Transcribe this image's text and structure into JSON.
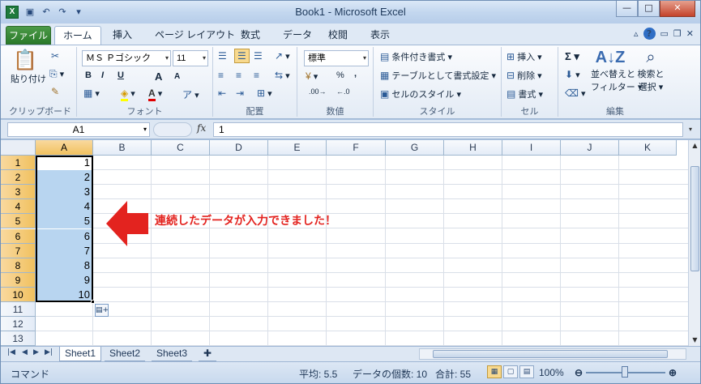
{
  "window": {
    "title": "Book1 - Microsoft Excel",
    "app_icon": "X"
  },
  "quick_access": [
    "save-icon",
    "undo-icon",
    "redo-icon",
    "customize-icon"
  ],
  "ribbon_tabs": [
    "ファイル",
    "ホーム",
    "挿入",
    "ページ レイアウト",
    "数式",
    "データ",
    "校閲",
    "表示"
  ],
  "clipboard": {
    "paste": "貼り付け",
    "label": "クリップボード"
  },
  "font": {
    "name": "ＭＳ Ｐゴシック",
    "size": "11",
    "label": "フォント",
    "bold": "B",
    "italic": "I",
    "underline": "U",
    "grow": "A",
    "shrink": "A"
  },
  "alignment": {
    "label": "配置"
  },
  "number": {
    "format": "標準",
    "label": "数値",
    "percent": "%",
    "comma": ","
  },
  "styles": {
    "conditional": "条件付き書式",
    "table": "テーブルとして書式設定",
    "cell_styles": "セルのスタイル",
    "label": "スタイル"
  },
  "cells": {
    "insert": "挿入",
    "delete": "削除",
    "format": "書式",
    "label": "セル"
  },
  "editing": {
    "sort": "並べ替えと",
    "filter": "フィルター",
    "find": "検索と",
    "select": "選択",
    "label": "編集",
    "sigma": "Σ"
  },
  "formula_bar": {
    "name_box": "A1",
    "fx": "fx",
    "value": "1"
  },
  "columns": [
    "A",
    "B",
    "C",
    "D",
    "E",
    "F",
    "G",
    "H",
    "I",
    "J",
    "K"
  ],
  "rows": [
    "1",
    "2",
    "3",
    "4",
    "5",
    "6",
    "7",
    "8",
    "9",
    "10",
    "11",
    "12",
    "13"
  ],
  "cells_a": [
    "1",
    "2",
    "3",
    "4",
    "5",
    "6",
    "7",
    "8",
    "9",
    "10"
  ],
  "callout": "連続したデータが入力できました！",
  "accent": {
    "arrow": "#e3231f",
    "selection": "#b8d5f0"
  },
  "sheet_tabs": [
    "Sheet1",
    "Sheet2",
    "Sheet3"
  ],
  "status": {
    "mode": "コマンド",
    "average": "平均: 5.5",
    "count": "データの個数: 10",
    "sum": "合計: 55",
    "zoom": "100%"
  }
}
